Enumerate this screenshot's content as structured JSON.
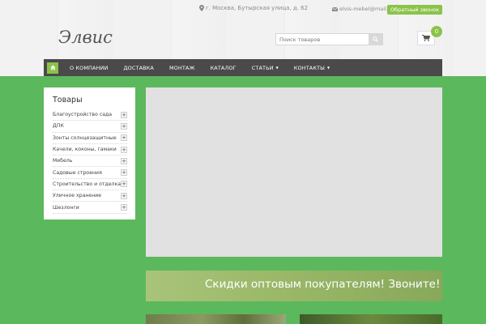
{
  "topbar": {
    "address": "г. Москва, Бутырская улица, д. 62",
    "email": "elvis-mebel@mail.ru",
    "callback_label": "Обратный звонок"
  },
  "header": {
    "logo": "Элвис",
    "search_placeholder": "Поиск товаров",
    "cart_count": "0"
  },
  "nav": {
    "items": [
      {
        "label": "О компании"
      },
      {
        "label": "Доставка"
      },
      {
        "label": "Монтаж"
      },
      {
        "label": "Каталог"
      },
      {
        "label": "Статьи"
      },
      {
        "label": "Контакты"
      }
    ]
  },
  "sidebar": {
    "title": "Товары",
    "items": [
      {
        "label": "Благоустройство сада"
      },
      {
        "label": "ДПК"
      },
      {
        "label": "Зонты солнцезащитные"
      },
      {
        "label": "Качели, коконы, гамаки"
      },
      {
        "label": "Мебель"
      },
      {
        "label": "Садовые строения"
      },
      {
        "label": "Строительство и отделка"
      },
      {
        "label": "Уличное хранение"
      },
      {
        "label": "Шезлонги"
      }
    ]
  },
  "promo": {
    "text": "Скидки оптовым покупателям! Звоните!"
  },
  "icons": {
    "home": "home-icon",
    "search": "search-icon",
    "cart": "cart-icon",
    "map_marker": "map-marker-icon",
    "envelope": "envelope-icon",
    "plus": "plus-icon"
  },
  "colors": {
    "background_green": "#5cb85c",
    "accent_green": "#8bc34a",
    "navbar": "#4a4a4a"
  }
}
